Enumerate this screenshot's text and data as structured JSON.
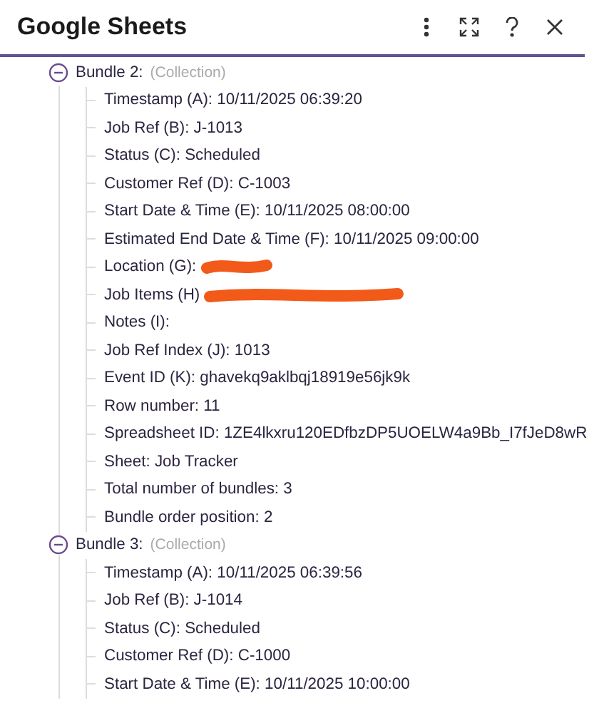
{
  "window": {
    "title": "Google Sheets"
  },
  "bundles": [
    {
      "label": "Bundle 2:",
      "type": "(Collection)",
      "expanded": true,
      "fields": [
        {
          "label": "Timestamp (A):",
          "value": "10/11/2025 06:39:20"
        },
        {
          "label": "Job Ref (B):",
          "value": "J-1013"
        },
        {
          "label": "Status (C):",
          "value": "Scheduled"
        },
        {
          "label": "Customer Ref (D):",
          "value": "C-1003"
        },
        {
          "label": "Start Date & Time (E):",
          "value": "10/11/2025 08:00:00"
        },
        {
          "label": "Estimated End Date & Time (F):",
          "value": "10/11/2025 09:00:00"
        },
        {
          "label": "Location (G):",
          "redacted": true
        },
        {
          "label": "Job Items (H)",
          "redacted": true
        },
        {
          "label": "Notes (I):"
        },
        {
          "label": "Job Ref Index (J):",
          "value": "1013"
        },
        {
          "label": "Event ID (K):",
          "value": "ghavekq9aklbqj18919e56jk9k"
        },
        {
          "label": "Row number:",
          "value": "11"
        },
        {
          "label": "Spreadsheet ID:",
          "value": "1ZE4lkxru120EDfbzDP5UOELW4a9Bb_I7fJeD8wR"
        },
        {
          "label": "Sheet:",
          "value": "Job Tracker"
        },
        {
          "label": "Total number of bundles:",
          "value": "3"
        },
        {
          "label": "Bundle order position:",
          "value": "2"
        }
      ]
    },
    {
      "label": "Bundle 3:",
      "type": "(Collection)",
      "expanded": true,
      "fields": [
        {
          "label": "Timestamp (A):",
          "value": "10/11/2025 06:39:56"
        },
        {
          "label": "Job Ref (B):",
          "value": "J-1014"
        },
        {
          "label": "Status (C):",
          "value": "Scheduled"
        },
        {
          "label": "Customer Ref (D):",
          "value": "C-1000"
        },
        {
          "label": "Start Date & Time (E):",
          "value": "10/11/2025 10:00:00"
        }
      ]
    }
  ]
}
